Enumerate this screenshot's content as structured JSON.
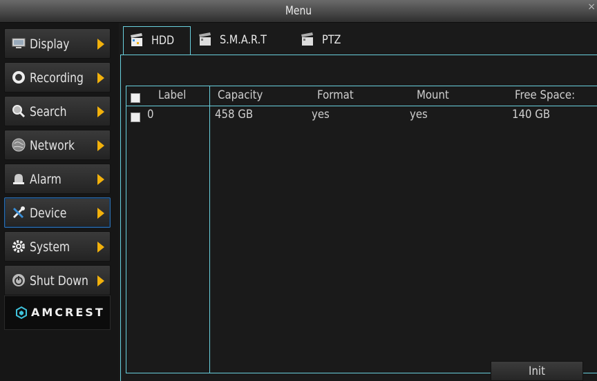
{
  "window": {
    "title": "Menu",
    "close_label": "×"
  },
  "sidebar": {
    "items": [
      {
        "label": "Display",
        "icon": "monitor-icon"
      },
      {
        "label": "Recording",
        "icon": "record-icon"
      },
      {
        "label": "Search",
        "icon": "search-icon"
      },
      {
        "label": "Network",
        "icon": "globe-icon"
      },
      {
        "label": "Alarm",
        "icon": "alarm-bell-icon"
      },
      {
        "label": "Device",
        "icon": "tools-icon",
        "active": true
      },
      {
        "label": "System",
        "icon": "gear-icon"
      },
      {
        "label": "Shut Down",
        "icon": "power-icon"
      }
    ],
    "brand": "AMCREST"
  },
  "tabs": [
    {
      "label": "HDD",
      "active": true
    },
    {
      "label": "S.M.A.R.T"
    },
    {
      "label": "PTZ"
    }
  ],
  "table": {
    "columns": [
      "Label",
      "Capacity",
      "Format",
      "Mount",
      "Free Space:"
    ],
    "rows": [
      [
        "0",
        "458 GB",
        "yes",
        "yes",
        "140 GB"
      ]
    ]
  },
  "buttons": {
    "init": "Init"
  },
  "colors": {
    "accent_border": "#6ad2e0",
    "arrow": "#f2b10c",
    "active_item_border": "#2e6fb0"
  }
}
